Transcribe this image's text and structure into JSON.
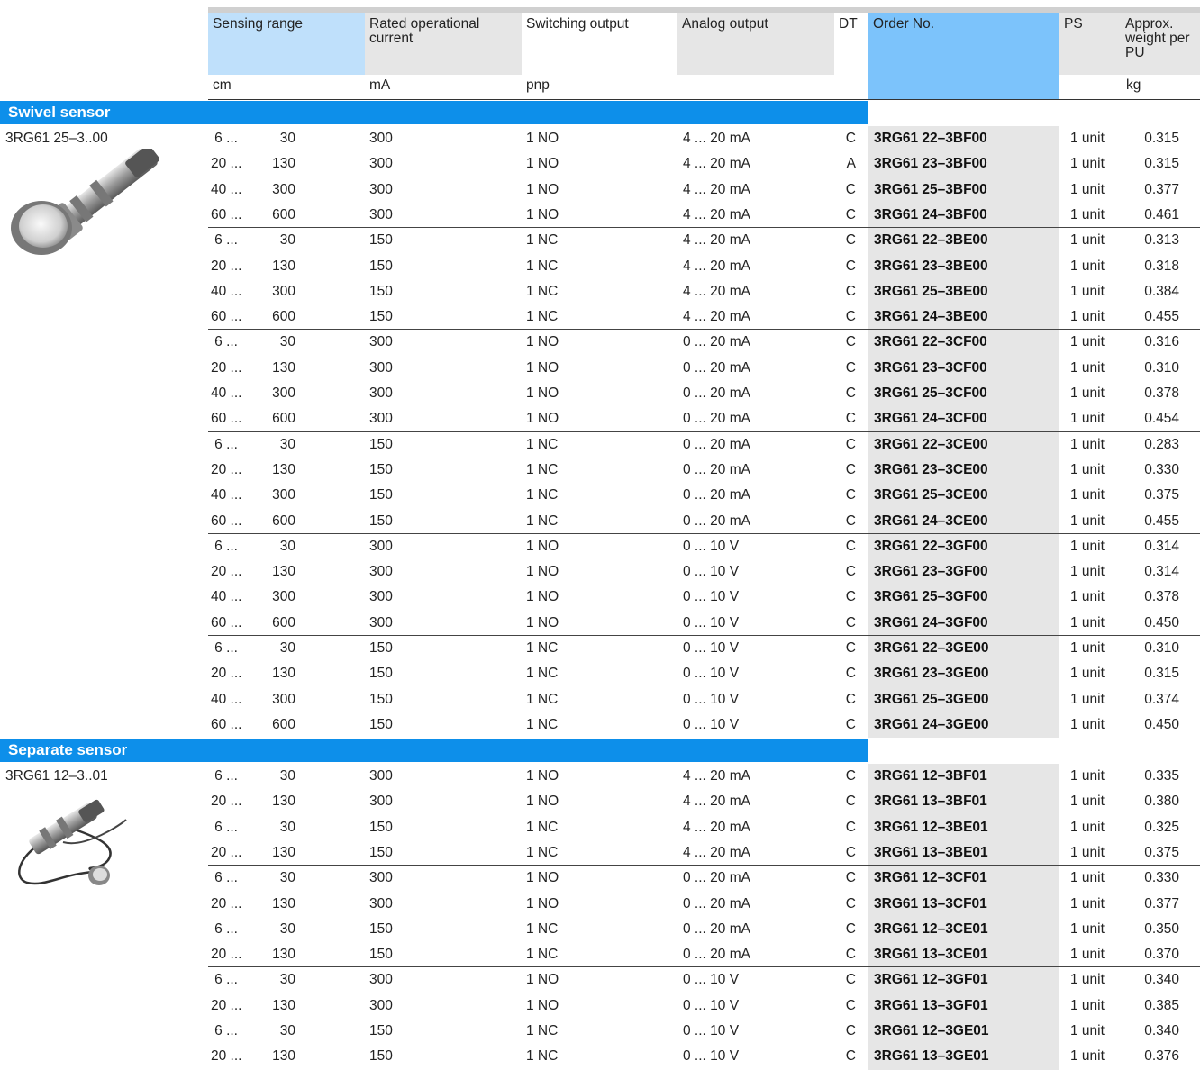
{
  "headers": {
    "sensing_range": "Sensing range",
    "rated_current": "Rated operational current",
    "switching_output": "Switching output",
    "analog_output": "Analog output",
    "dt": "DT",
    "order_no": "Order No.",
    "ps": "PS",
    "weight": "Approx. weight per PU"
  },
  "units": {
    "sensing_range": "cm",
    "current": "mA",
    "switching": "pnp",
    "weight": "kg"
  },
  "sections": [
    {
      "title": "Swivel sensor",
      "product_type": "3RG61 25–3..00",
      "image_icon": "swivel-sensor-image",
      "rows": [
        [
          "6 ...",
          "30",
          "300",
          "1 NO",
          "4 ... 20 mA",
          "C",
          "3RG61 22–3BF00",
          "1 unit",
          "0.315"
        ],
        [
          "20 ...",
          "130",
          "300",
          "1 NO",
          "4 ... 20 mA",
          "A",
          "3RG61 23–3BF00",
          "1 unit",
          "0.315"
        ],
        [
          "40 ...",
          "300",
          "300",
          "1 NO",
          "4 ... 20 mA",
          "C",
          "3RG61 25–3BF00",
          "1 unit",
          "0.377"
        ],
        [
          "60 ...",
          "600",
          "300",
          "1 NO",
          "4 ... 20 mA",
          "C",
          "3RG61 24–3BF00",
          "1 unit",
          "0.461"
        ],
        [
          "6 ...",
          "30",
          "150",
          "1 NC",
          "4 ... 20 mA",
          "C",
          "3RG61 22–3BE00",
          "1 unit",
          "0.313"
        ],
        [
          "20 ...",
          "130",
          "150",
          "1 NC",
          "4 ... 20 mA",
          "C",
          "3RG61 23–3BE00",
          "1 unit",
          "0.318"
        ],
        [
          "40 ...",
          "300",
          "150",
          "1 NC",
          "4 ... 20 mA",
          "C",
          "3RG61 25–3BE00",
          "1 unit",
          "0.384"
        ],
        [
          "60 ...",
          "600",
          "150",
          "1 NC",
          "4 ... 20 mA",
          "C",
          "3RG61 24–3BE00",
          "1 unit",
          "0.455"
        ],
        [
          "6 ...",
          "30",
          "300",
          "1 NO",
          "0 ... 20 mA",
          "C",
          "3RG61 22–3CF00",
          "1 unit",
          "0.316"
        ],
        [
          "20 ...",
          "130",
          "300",
          "1 NO",
          "0 ... 20 mA",
          "C",
          "3RG61 23–3CF00",
          "1 unit",
          "0.310"
        ],
        [
          "40 ...",
          "300",
          "300",
          "1 NO",
          "0 ... 20 mA",
          "C",
          "3RG61 25–3CF00",
          "1 unit",
          "0.378"
        ],
        [
          "60 ...",
          "600",
          "300",
          "1 NO",
          "0 ... 20 mA",
          "C",
          "3RG61 24–3CF00",
          "1 unit",
          "0.454"
        ],
        [
          "6 ...",
          "30",
          "150",
          "1 NC",
          "0 ... 20 mA",
          "C",
          "3RG61 22–3CE00",
          "1 unit",
          "0.283"
        ],
        [
          "20 ...",
          "130",
          "150",
          "1 NC",
          "0 ... 20 mA",
          "C",
          "3RG61 23–3CE00",
          "1 unit",
          "0.330"
        ],
        [
          "40 ...",
          "300",
          "150",
          "1 NC",
          "0 ... 20 mA",
          "C",
          "3RG61 25–3CE00",
          "1 unit",
          "0.375"
        ],
        [
          "60 ...",
          "600",
          "150",
          "1 NC",
          "0 ... 20 mA",
          "C",
          "3RG61 24–3CE00",
          "1 unit",
          "0.455"
        ],
        [
          "6 ...",
          "30",
          "300",
          "1 NO",
          "0 ... 10 V",
          "C",
          "3RG61 22–3GF00",
          "1 unit",
          "0.314"
        ],
        [
          "20 ...",
          "130",
          "300",
          "1 NO",
          "0 ... 10 V",
          "C",
          "3RG61 23–3GF00",
          "1 unit",
          "0.314"
        ],
        [
          "40 ...",
          "300",
          "300",
          "1 NO",
          "0 ... 10 V",
          "C",
          "3RG61 25–3GF00",
          "1 unit",
          "0.378"
        ],
        [
          "60 ...",
          "600",
          "300",
          "1 NO",
          "0 ... 10 V",
          "C",
          "3RG61 24–3GF00",
          "1 unit",
          "0.450"
        ],
        [
          "6 ...",
          "30",
          "150",
          "1 NC",
          "0 ... 10 V",
          "C",
          "3RG61 22–3GE00",
          "1 unit",
          "0.310"
        ],
        [
          "20 ...",
          "130",
          "150",
          "1 NC",
          "0 ... 10 V",
          "C",
          "3RG61 23–3GE00",
          "1 unit",
          "0.315"
        ],
        [
          "40 ...",
          "300",
          "150",
          "1 NC",
          "0 ... 10 V",
          "C",
          "3RG61 25–3GE00",
          "1 unit",
          "0.374"
        ],
        [
          "60 ...",
          "600",
          "150",
          "1 NC",
          "0 ... 10 V",
          "C",
          "3RG61 24–3GE00",
          "1 unit",
          "0.450"
        ]
      ]
    },
    {
      "title": "Separate sensor",
      "product_type": "3RG61 12–3..01",
      "image_icon": "separate-sensor-image",
      "rows": [
        [
          "6 ...",
          "30",
          "300",
          "1 NO",
          "4 ... 20 mA",
          "C",
          "3RG61 12–3BF01",
          "1 unit",
          "0.335"
        ],
        [
          "20 ...",
          "130",
          "300",
          "1 NO",
          "4 ... 20 mA",
          "C",
          "3RG61 13–3BF01",
          "1 unit",
          "0.380"
        ],
        [
          "6 ...",
          "30",
          "150",
          "1 NC",
          "4 ... 20 mA",
          "C",
          "3RG61 12–3BE01",
          "1 unit",
          "0.325"
        ],
        [
          "20 ...",
          "130",
          "150",
          "1 NC",
          "4 ... 20 mA",
          "C",
          "3RG61 13–3BE01",
          "1 unit",
          "0.375"
        ],
        [
          "6 ...",
          "30",
          "300",
          "1 NO",
          "0 ... 20 mA",
          "C",
          "3RG61 12–3CF01",
          "1 unit",
          "0.330"
        ],
        [
          "20 ...",
          "130",
          "300",
          "1 NO",
          "0 ... 20 mA",
          "C",
          "3RG61 13–3CF01",
          "1 unit",
          "0.377"
        ],
        [
          "6 ...",
          "30",
          "150",
          "1 NC",
          "0 ... 20 mA",
          "C",
          "3RG61 12–3CE01",
          "1 unit",
          "0.350"
        ],
        [
          "20 ...",
          "130",
          "150",
          "1 NC",
          "0 ... 20 mA",
          "C",
          "3RG61 13–3CE01",
          "1 unit",
          "0.370"
        ],
        [
          "6 ...",
          "30",
          "300",
          "1 NO",
          "0 ... 10 V",
          "C",
          "3RG61 12–3GF01",
          "1 unit",
          "0.340"
        ],
        [
          "20 ...",
          "130",
          "300",
          "1 NO",
          "0 ... 10 V",
          "C",
          "3RG61 13–3GF01",
          "1 unit",
          "0.385"
        ],
        [
          "6 ...",
          "30",
          "150",
          "1 NC",
          "0 ... 10 V",
          "C",
          "3RG61 12–3GE01",
          "1 unit",
          "0.340"
        ],
        [
          "20 ...",
          "130",
          "150",
          "1 NC",
          "0 ... 10 V",
          "C",
          "3RG61 13–3GE01",
          "1 unit",
          "0.376"
        ]
      ]
    }
  ]
}
